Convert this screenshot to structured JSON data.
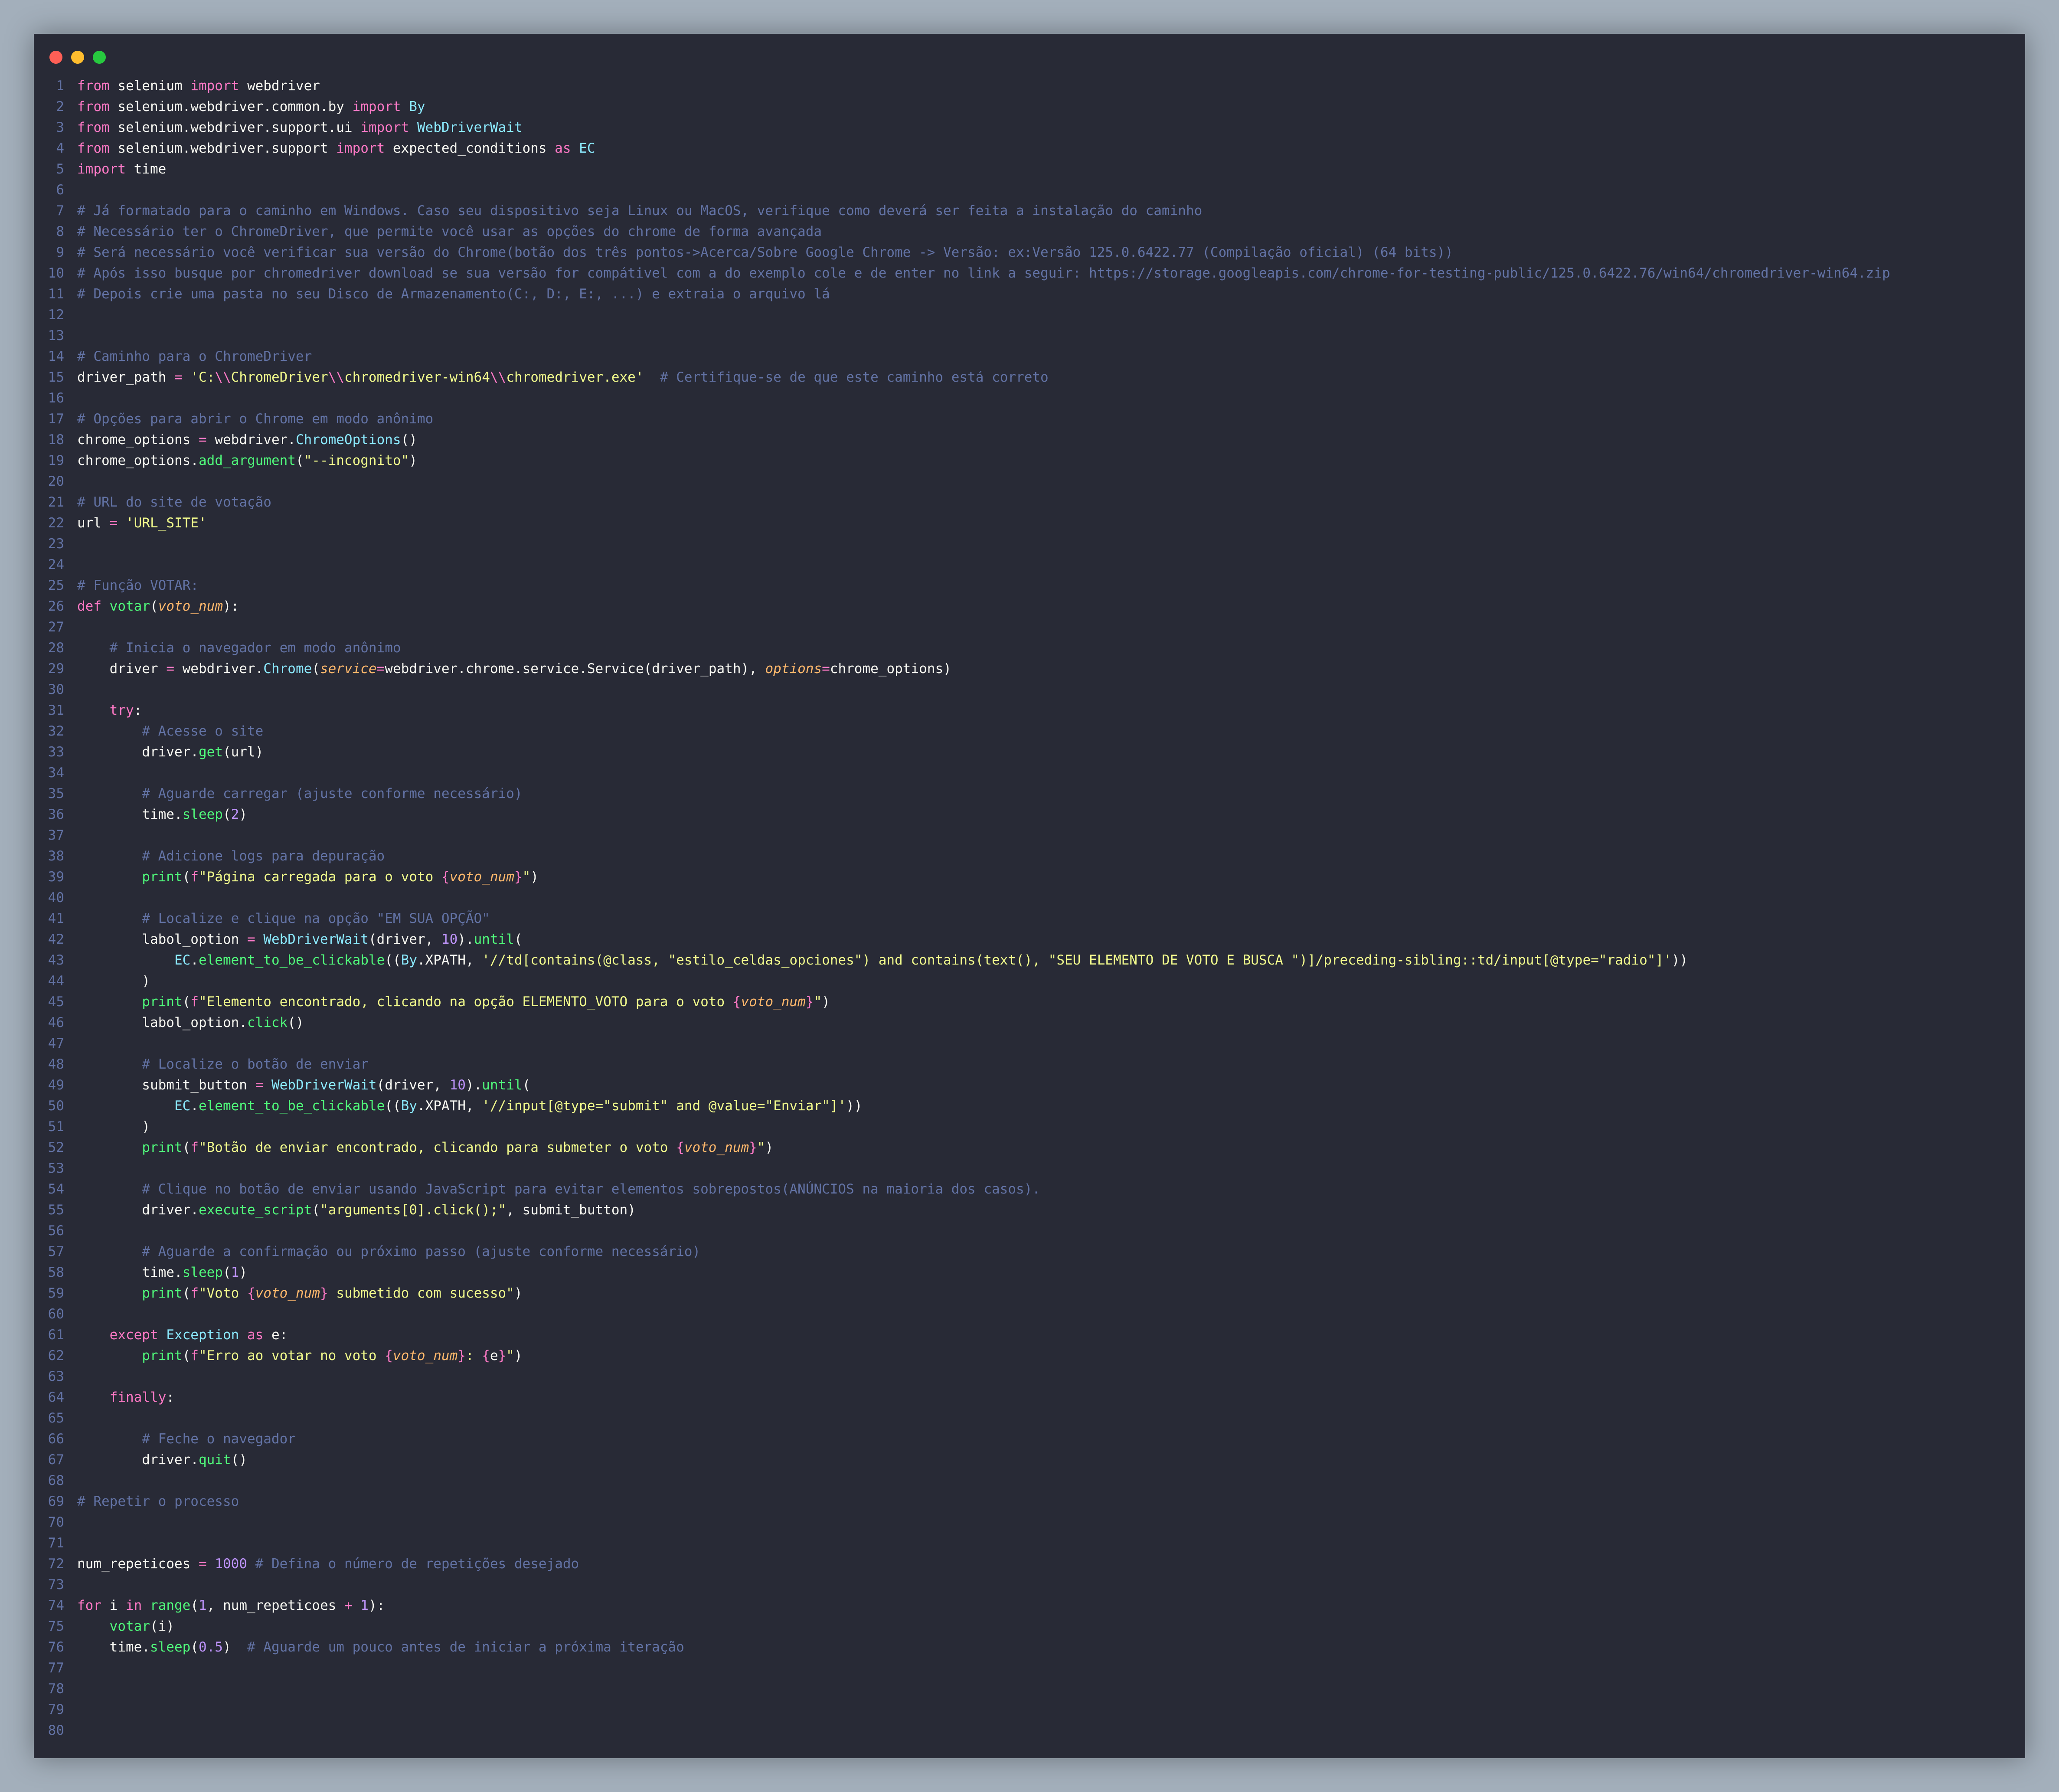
{
  "window": {
    "controls": [
      {
        "name": "close",
        "color": "#ff5f56"
      },
      {
        "name": "minimize",
        "color": "#ffbd2e"
      },
      {
        "name": "maximize",
        "color": "#27c93f"
      }
    ]
  },
  "colors": {
    "background": "#282a36",
    "keyword": "#ff79c6",
    "comment": "#6272a4",
    "string": "#f1fa8c",
    "function": "#50fa7b",
    "class": "#8be9fd",
    "number": "#bd93f9",
    "parameter": "#ffb86c",
    "text": "#f8f8f2"
  },
  "lines": [
    [
      [
        "kw",
        "from"
      ],
      [
        "",
        " selenium "
      ],
      [
        "kw",
        "import"
      ],
      [
        "",
        " webdriver"
      ]
    ],
    [
      [
        "kw",
        "from"
      ],
      [
        "",
        " selenium.webdriver.common.by "
      ],
      [
        "kw",
        "import"
      ],
      [
        "",
        " "
      ],
      [
        "cl",
        "By"
      ]
    ],
    [
      [
        "kw",
        "from"
      ],
      [
        "",
        " selenium.webdriver.support.ui "
      ],
      [
        "kw",
        "import"
      ],
      [
        "",
        " "
      ],
      [
        "cl",
        "WebDriverWait"
      ]
    ],
    [
      [
        "kw",
        "from"
      ],
      [
        "",
        " selenium.webdriver.support "
      ],
      [
        "kw",
        "import"
      ],
      [
        "",
        " expected_conditions "
      ],
      [
        "kw",
        "as"
      ],
      [
        "",
        " "
      ],
      [
        "cl",
        "EC"
      ]
    ],
    [
      [
        "kw",
        "import"
      ],
      [
        "",
        " time"
      ]
    ],
    [],
    [
      [
        "cm",
        "# Já formatado para o caminho em Windows. Caso seu dispositivo seja Linux ou MacOS, verifique como deverá ser feita a instalação do caminho"
      ]
    ],
    [
      [
        "cm",
        "# Necessário ter o ChromeDriver, que permite você usar as opções do chrome de forma avançada"
      ]
    ],
    [
      [
        "cm",
        "# Será necessário você verificar sua versão do Chrome(botão dos três pontos->Acerca/Sobre Google Chrome -> Versão: ex:Versão 125.0.6422.77 (Compilação oficial) (64 bits))"
      ]
    ],
    [
      [
        "cm",
        "# Após isso busque por chromedriver download se sua versão for compátivel com a do exemplo cole e de enter no link a seguir: https://storage.googleapis.com/chrome-for-testing-public/125.0.6422.76/win64/chromedriver-win64.zip"
      ]
    ],
    [
      [
        "cm",
        "# Depois crie uma pasta no seu Disco de Armazenamento(C:, D:, E:, ...) e extraia o arquivo lá"
      ]
    ],
    [],
    [],
    [
      [
        "cm",
        "# Caminho para o ChromeDriver"
      ]
    ],
    [
      [
        "",
        "driver_path "
      ],
      [
        "op",
        "="
      ],
      [
        "",
        " "
      ],
      [
        "st",
        "'C:"
      ],
      [
        "kw",
        "\\\\"
      ],
      [
        "st",
        "ChromeDriver"
      ],
      [
        "kw",
        "\\\\"
      ],
      [
        "st",
        "chromedriver-win64"
      ],
      [
        "kw",
        "\\\\"
      ],
      [
        "st",
        "chromedriver.exe'"
      ],
      [
        "",
        "  "
      ],
      [
        "cm",
        "# Certifique-se de que este caminho está correto"
      ]
    ],
    [],
    [
      [
        "cm",
        "# Opções para abrir o Chrome em modo anônimo"
      ]
    ],
    [
      [
        "",
        "chrome_options "
      ],
      [
        "op",
        "="
      ],
      [
        "",
        " webdriver."
      ],
      [
        "cl",
        "ChromeOptions"
      ],
      [
        "",
        "()"
      ]
    ],
    [
      [
        "",
        "chrome_options."
      ],
      [
        "fn",
        "add_argument"
      ],
      [
        "",
        "("
      ],
      [
        "st",
        "\"--incognito\""
      ],
      [
        "",
        ")"
      ]
    ],
    [],
    [
      [
        "cm",
        "# URL do site de votação"
      ]
    ],
    [
      [
        "",
        "url "
      ],
      [
        "op",
        "="
      ],
      [
        "",
        " "
      ],
      [
        "st",
        "'URL_SITE'"
      ]
    ],
    [],
    [],
    [
      [
        "cm",
        "# Função VOTAR:"
      ]
    ],
    [
      [
        "kw",
        "def"
      ],
      [
        "",
        " "
      ],
      [
        "fn",
        "votar"
      ],
      [
        "",
        "("
      ],
      [
        "pa",
        "voto_num"
      ],
      [
        "",
        "):"
      ]
    ],
    [],
    [
      [
        "",
        "    "
      ],
      [
        "cm",
        "# Inicia o navegador em modo anônimo"
      ]
    ],
    [
      [
        "",
        "    driver "
      ],
      [
        "op",
        "="
      ],
      [
        "",
        " webdriver."
      ],
      [
        "cl",
        "Chrome"
      ],
      [
        "",
        "("
      ],
      [
        "pa",
        "service"
      ],
      [
        "op",
        "="
      ],
      [
        "",
        "webdriver.chrome.service.Service(driver_path), "
      ],
      [
        "pa",
        "options"
      ],
      [
        "op",
        "="
      ],
      [
        "",
        "chrome_options)"
      ]
    ],
    [],
    [
      [
        "",
        "    "
      ],
      [
        "kw",
        "try"
      ],
      [
        "",
        ":"
      ]
    ],
    [
      [
        "",
        "        "
      ],
      [
        "cm",
        "# Acesse o site"
      ]
    ],
    [
      [
        "",
        "        driver."
      ],
      [
        "fn",
        "get"
      ],
      [
        "",
        "(url)"
      ]
    ],
    [],
    [
      [
        "",
        "        "
      ],
      [
        "cm",
        "# Aguarde carregar (ajuste conforme necessário)"
      ]
    ],
    [
      [
        "",
        "        time."
      ],
      [
        "fn",
        "sleep"
      ],
      [
        "",
        "("
      ],
      [
        "nm",
        "2"
      ],
      [
        "",
        ")"
      ]
    ],
    [],
    [
      [
        "",
        "        "
      ],
      [
        "cm",
        "# Adicione logs para depuração"
      ]
    ],
    [
      [
        "",
        "        "
      ],
      [
        "fn",
        "print"
      ],
      [
        "",
        "("
      ],
      [
        "kw",
        "f"
      ],
      [
        "st",
        "\"Página carregada para o voto "
      ],
      [
        "kw",
        "{"
      ],
      [
        "pa",
        "voto_num"
      ],
      [
        "kw",
        "}"
      ],
      [
        "st",
        "\""
      ],
      [
        "",
        ")"
      ]
    ],
    [],
    [
      [
        "",
        "        "
      ],
      [
        "cm",
        "# Localize e clique na opção \"EM SUA OPÇÃO\""
      ]
    ],
    [
      [
        "",
        "        labol_option "
      ],
      [
        "op",
        "="
      ],
      [
        "",
        " "
      ],
      [
        "cl",
        "WebDriverWait"
      ],
      [
        "",
        "(driver, "
      ],
      [
        "nm",
        "10"
      ],
      [
        "",
        ")."
      ],
      [
        "fn",
        "until"
      ],
      [
        "",
        "("
      ]
    ],
    [
      [
        "",
        "            "
      ],
      [
        "cl",
        "EC"
      ],
      [
        "",
        "."
      ],
      [
        "fn",
        "element_to_be_clickable"
      ],
      [
        "",
        "(("
      ],
      [
        "cl",
        "By"
      ],
      [
        "",
        ".XPATH, "
      ],
      [
        "st",
        "'//td[contains(@class, \"estilo_celdas_opciones\") and contains(text(), \"SEU ELEMENTO DE VOTO E BUSCA \")]/preceding-sibling::td/input[@type=\"radio\"]'"
      ],
      [
        "",
        "))"
      ]
    ],
    [
      [
        "",
        "        )"
      ]
    ],
    [
      [
        "",
        "        "
      ],
      [
        "fn",
        "print"
      ],
      [
        "",
        "("
      ],
      [
        "kw",
        "f"
      ],
      [
        "st",
        "\"Elemento encontrado, clicando na opção ELEMENTO_VOTO para o voto "
      ],
      [
        "kw",
        "{"
      ],
      [
        "pa",
        "voto_num"
      ],
      [
        "kw",
        "}"
      ],
      [
        "st",
        "\""
      ],
      [
        "",
        ")"
      ]
    ],
    [
      [
        "",
        "        labol_option."
      ],
      [
        "fn",
        "click"
      ],
      [
        "",
        "()"
      ]
    ],
    [],
    [
      [
        "",
        "        "
      ],
      [
        "cm",
        "# Localize o botão de enviar"
      ]
    ],
    [
      [
        "",
        "        submit_button "
      ],
      [
        "op",
        "="
      ],
      [
        "",
        " "
      ],
      [
        "cl",
        "WebDriverWait"
      ],
      [
        "",
        "(driver, "
      ],
      [
        "nm",
        "10"
      ],
      [
        "",
        ")."
      ],
      [
        "fn",
        "until"
      ],
      [
        "",
        "("
      ]
    ],
    [
      [
        "",
        "            "
      ],
      [
        "cl",
        "EC"
      ],
      [
        "",
        "."
      ],
      [
        "fn",
        "element_to_be_clickable"
      ],
      [
        "",
        "(("
      ],
      [
        "cl",
        "By"
      ],
      [
        "",
        ".XPATH, "
      ],
      [
        "st",
        "'//input[@type=\"submit\" and @value=\"Enviar\"]'"
      ],
      [
        "",
        "))"
      ]
    ],
    [
      [
        "",
        "        )"
      ]
    ],
    [
      [
        "",
        "        "
      ],
      [
        "fn",
        "print"
      ],
      [
        "",
        "("
      ],
      [
        "kw",
        "f"
      ],
      [
        "st",
        "\"Botão de enviar encontrado, clicando para submeter o voto "
      ],
      [
        "kw",
        "{"
      ],
      [
        "pa",
        "voto_num"
      ],
      [
        "kw",
        "}"
      ],
      [
        "st",
        "\""
      ],
      [
        "",
        ")"
      ]
    ],
    [],
    [
      [
        "",
        "        "
      ],
      [
        "cm",
        "# Clique no botão de enviar usando JavaScript para evitar elementos sobrepostos(ANÚNCIOS na maioria dos casos)."
      ]
    ],
    [
      [
        "",
        "        driver."
      ],
      [
        "fn",
        "execute_script"
      ],
      [
        "",
        "("
      ],
      [
        "st",
        "\"arguments[0].click();\""
      ],
      [
        "",
        ", submit_button)"
      ]
    ],
    [],
    [
      [
        "",
        "        "
      ],
      [
        "cm",
        "# Aguarde a confirmação ou próximo passo (ajuste conforme necessário)"
      ]
    ],
    [
      [
        "",
        "        time."
      ],
      [
        "fn",
        "sleep"
      ],
      [
        "",
        "("
      ],
      [
        "nm",
        "1"
      ],
      [
        "",
        ")"
      ]
    ],
    [
      [
        "",
        "        "
      ],
      [
        "fn",
        "print"
      ],
      [
        "",
        "("
      ],
      [
        "kw",
        "f"
      ],
      [
        "st",
        "\"Voto "
      ],
      [
        "kw",
        "{"
      ],
      [
        "pa",
        "voto_num"
      ],
      [
        "kw",
        "}"
      ],
      [
        "st",
        " submetido com sucesso\""
      ],
      [
        "",
        ")"
      ]
    ],
    [],
    [
      [
        "",
        "    "
      ],
      [
        "kw",
        "except"
      ],
      [
        "",
        " "
      ],
      [
        "cl",
        "Exception"
      ],
      [
        "",
        " "
      ],
      [
        "kw",
        "as"
      ],
      [
        "",
        " e:"
      ]
    ],
    [
      [
        "",
        "        "
      ],
      [
        "fn",
        "print"
      ],
      [
        "",
        "("
      ],
      [
        "kw",
        "f"
      ],
      [
        "st",
        "\"Erro ao votar no voto "
      ],
      [
        "kw",
        "{"
      ],
      [
        "pa",
        "voto_num"
      ],
      [
        "kw",
        "}"
      ],
      [
        "st",
        ": "
      ],
      [
        "kw",
        "{"
      ],
      [
        "",
        "e"
      ],
      [
        "kw",
        "}"
      ],
      [
        "st",
        "\""
      ],
      [
        "",
        ")"
      ]
    ],
    [],
    [
      [
        "",
        "    "
      ],
      [
        "kw",
        "finally"
      ],
      [
        "",
        ":"
      ]
    ],
    [],
    [
      [
        "",
        "        "
      ],
      [
        "cm",
        "# Feche o navegador"
      ]
    ],
    [
      [
        "",
        "        driver."
      ],
      [
        "fn",
        "quit"
      ],
      [
        "",
        "()"
      ]
    ],
    [],
    [
      [
        "cm",
        "# Repetir o processo"
      ]
    ],
    [],
    [],
    [
      [
        "",
        "num_repeticoes "
      ],
      [
        "op",
        "="
      ],
      [
        "",
        " "
      ],
      [
        "nm",
        "1000"
      ],
      [
        "",
        " "
      ],
      [
        "cm",
        "# Defina o número de repetições desejado"
      ]
    ],
    [],
    [
      [
        "kw",
        "for"
      ],
      [
        "",
        " i "
      ],
      [
        "kw",
        "in"
      ],
      [
        "",
        " "
      ],
      [
        "fn",
        "range"
      ],
      [
        "",
        "("
      ],
      [
        "nm",
        "1"
      ],
      [
        "",
        ", num_repeticoes "
      ],
      [
        "op",
        "+"
      ],
      [
        "",
        " "
      ],
      [
        "nm",
        "1"
      ],
      [
        "",
        "):"
      ]
    ],
    [
      [
        "",
        "    "
      ],
      [
        "fn",
        "votar"
      ],
      [
        "",
        "(i)"
      ]
    ],
    [
      [
        "",
        "    time."
      ],
      [
        "fn",
        "sleep"
      ],
      [
        "",
        "("
      ],
      [
        "nm",
        "0.5"
      ],
      [
        "",
        ")  "
      ],
      [
        "cm",
        "# Aguarde um pouco antes de iniciar a próxima iteração"
      ]
    ],
    [],
    [],
    [],
    []
  ]
}
